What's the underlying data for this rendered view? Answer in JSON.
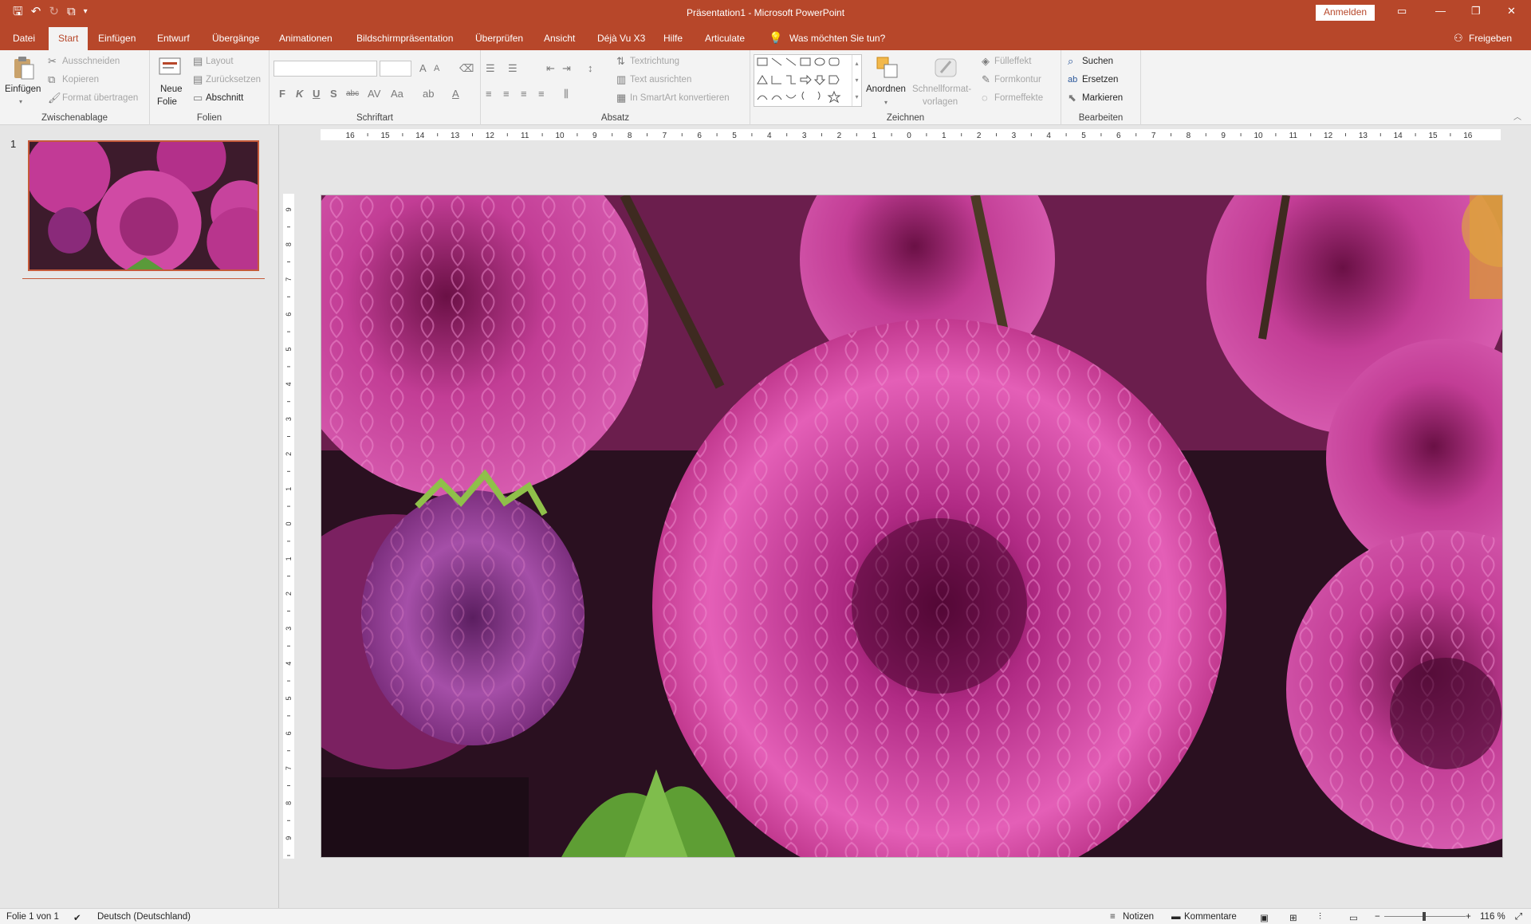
{
  "app": {
    "title": "Präsentation1  -  Microsoft PowerPoint",
    "signin": "Anmelden"
  },
  "tabs": [
    {
      "label": "Datei"
    },
    {
      "label": "Start"
    },
    {
      "label": "Einfügen"
    },
    {
      "label": "Entwurf"
    },
    {
      "label": "Übergänge"
    },
    {
      "label": "Animationen"
    },
    {
      "label": "Bildschirmpräsentation"
    },
    {
      "label": "Überprüfen"
    },
    {
      "label": "Ansicht"
    },
    {
      "label": "Déjà Vu X3"
    },
    {
      "label": "Hilfe"
    },
    {
      "label": "Articulate"
    }
  ],
  "tellme": "Was möchten Sie tun?",
  "share": "Freigeben",
  "ribbon": {
    "clipboard": {
      "paste": "Einfügen",
      "cut": "Ausschneiden",
      "copy": "Kopieren",
      "format_painter": "Format übertragen",
      "label": "Zwischenablage"
    },
    "slides": {
      "new_slide_1": "Neue",
      "new_slide_2": "Folie",
      "layout": "Layout",
      "reset": "Zurücksetzen",
      "section": "Abschnitt",
      "label": "Folien"
    },
    "font": {
      "label": "Schriftart",
      "bold": "F",
      "italic": "K",
      "underline": "U",
      "shadow": "S",
      "strike": "abc",
      "case": "Aa"
    },
    "paragraph": {
      "text_direction": "Textrichtung",
      "align_text": "Text ausrichten",
      "smartart": "In SmartArt konvertieren",
      "label": "Absatz"
    },
    "drawing": {
      "arrange": "Anordnen",
      "quick_styles_1": "Schnellformat-",
      "quick_styles_2": "vorlagen",
      "fill": "Fülleffekt",
      "outline": "Formkontur",
      "effects": "Formeffekte",
      "label": "Zeichnen"
    },
    "editing": {
      "find": "Suchen",
      "replace": "Ersetzen",
      "select": "Markieren",
      "label": "Bearbeiten"
    }
  },
  "thumbnail": {
    "number": "1"
  },
  "statusbar": {
    "slide": "Folie 1 von 1",
    "language": "Deutsch (Deutschland)",
    "notes": "Notizen",
    "comments": "Kommentare",
    "zoom": "116 %"
  },
  "colors": {
    "accent": "#b7472a",
    "ribbon_bg": "#f3f3f3",
    "workspace": "#e6e6e6"
  }
}
